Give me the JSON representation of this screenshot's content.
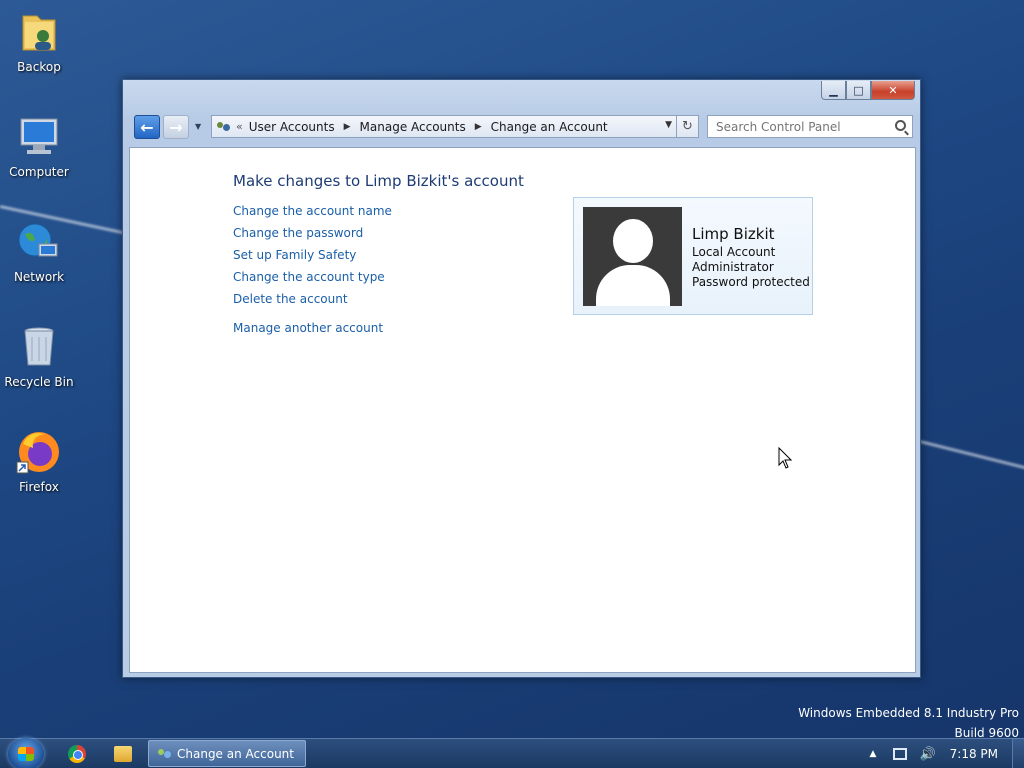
{
  "desktop": {
    "icons": [
      {
        "label": "Backop",
        "icon": "folder-user-icon"
      },
      {
        "label": "Computer",
        "icon": "computer-icon"
      },
      {
        "label": "Network",
        "icon": "network-globe-icon"
      },
      {
        "label": "Recycle Bin",
        "icon": "recycle-bin-icon"
      },
      {
        "label": "Firefox",
        "icon": "firefox-icon"
      }
    ]
  },
  "window": {
    "controls": {
      "minimize": "▁",
      "maximize": "□",
      "close": "✕"
    },
    "nav": {
      "back": "←",
      "forward": "→"
    },
    "breadcrumb": {
      "overflow": "«",
      "items": [
        "User Accounts",
        "Manage Accounts",
        "Change an Account"
      ],
      "separator": "▶"
    },
    "refresh": "↻",
    "search": {
      "placeholder": "Search Control Panel"
    },
    "page_title": "Make changes to Limp Bizkit's account",
    "tasks": [
      "Change the account name",
      "Change the password",
      "Set up Family Safety",
      "Change the account type",
      "Delete the account"
    ],
    "manage_another": "Manage another account",
    "account": {
      "name": "Limp Bizkit",
      "type": "Local Account",
      "role": "Administrator",
      "status": "Password protected"
    }
  },
  "watermark": {
    "line1": "Windows Embedded 8.1 Industry Pro",
    "line2": "Build 9600"
  },
  "taskbar": {
    "active_task": "Change an Account",
    "clock": "7:18 PM",
    "tray_arrow": "▲",
    "volume": "🔊"
  }
}
